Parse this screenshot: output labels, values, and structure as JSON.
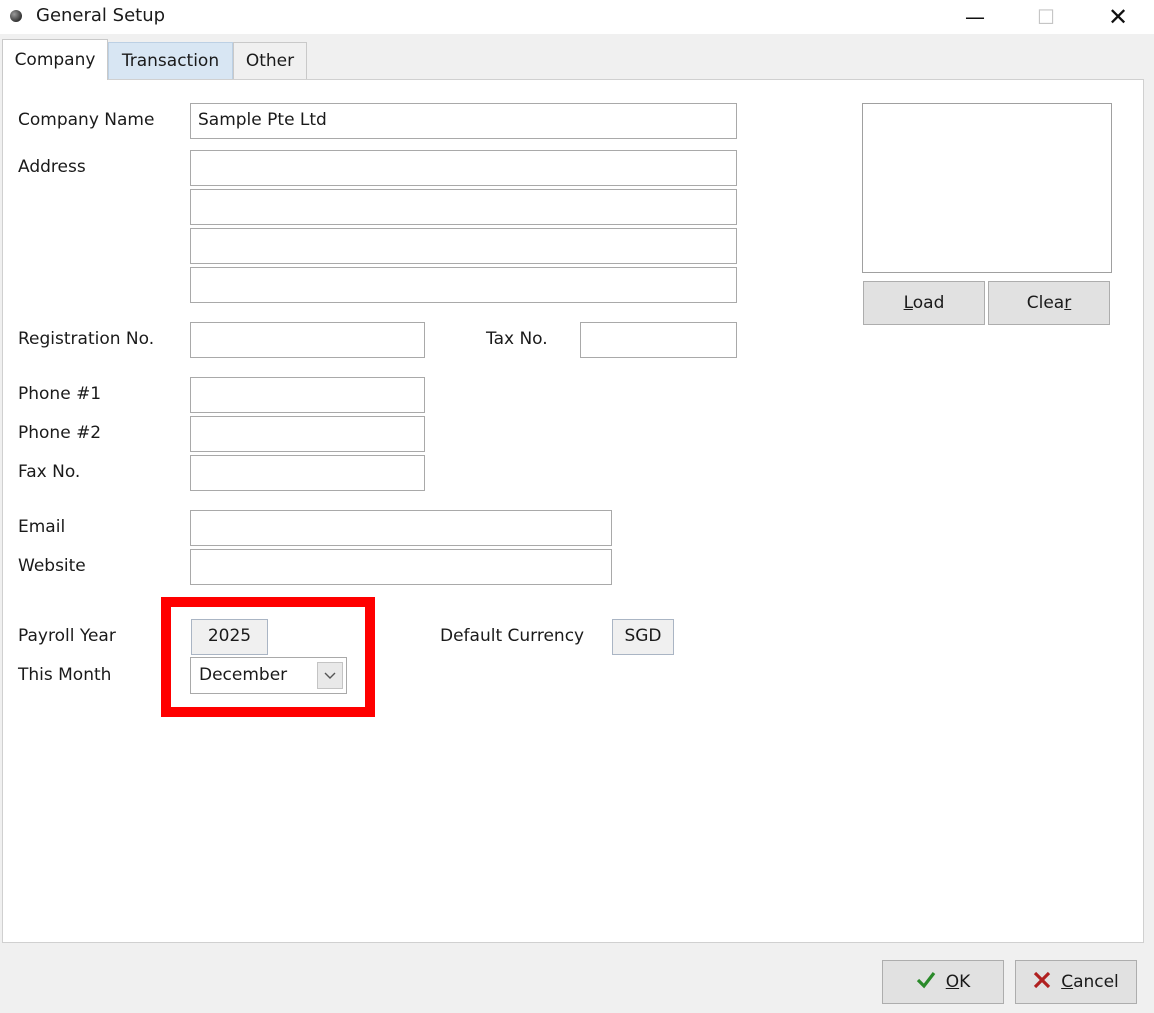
{
  "window": {
    "title": "General Setup",
    "minimize": "—",
    "maximize": "☐",
    "close": "✕"
  },
  "tabs": [
    {
      "label": "Company",
      "active": true
    },
    {
      "label": "Transaction",
      "active": false
    },
    {
      "label": "Other",
      "active": false
    }
  ],
  "form": {
    "company_name_label": "Company Name",
    "company_name_value": "Sample Pte Ltd",
    "address_label": "Address",
    "address_lines": [
      "",
      "",
      "",
      ""
    ],
    "registration_label": "Registration No.",
    "registration_value": "",
    "tax_label": "Tax No.",
    "tax_value": "",
    "phone1_label": "Phone #1",
    "phone1_value": "",
    "phone2_label": "Phone #2",
    "phone2_value": "",
    "fax_label": "Fax No.",
    "fax_value": "",
    "email_label": "Email",
    "email_value": "",
    "website_label": "Website",
    "website_value": "",
    "payroll_year_label": "Payroll Year",
    "payroll_year_value": "2025",
    "this_month_label": "This Month",
    "this_month_value": "December",
    "default_currency_label": "Default Currency",
    "default_currency_value": "SGD"
  },
  "logo": {
    "load_key": "L",
    "load_rest": "oad",
    "clear_start": "Clea",
    "clear_key": "r"
  },
  "footer": {
    "ok_key": "O",
    "ok_rest": "K",
    "cancel_key": "C",
    "cancel_rest": "ancel"
  },
  "colors": {
    "highlight": "#ff0000",
    "ok_icon": "#2a8a2a",
    "cancel_icon": "#b02020",
    "active_tab_alt": "#d8e6f3"
  },
  "icons": {
    "title": "app-dot-icon",
    "ok": "checkmark-icon",
    "cancel": "x-icon",
    "dropdown": "chevron-down-icon"
  }
}
